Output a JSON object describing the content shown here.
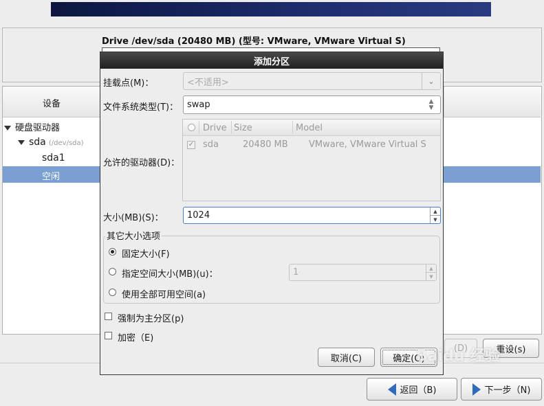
{
  "drive": {
    "title": "Drive /dev/sda (20480 MB) (型号: VMware, VMware Virtual S)"
  },
  "tree": {
    "column_device": "设备",
    "items": [
      {
        "label": "硬盘驱动器"
      },
      {
        "label": "sda",
        "sub": "(/dev/sda)"
      },
      {
        "label": "sda1"
      },
      {
        "label": "空闲"
      }
    ]
  },
  "dialog": {
    "title": "添加分区",
    "mount_point_label": "挂载点(M)：",
    "mount_point_value": "<不适用>",
    "fstype_label": "文件系统类型(T)：",
    "fstype_value": "swap",
    "allowed_drives_label": "允许的驱动器(D)：",
    "drives_table": {
      "headers": [
        "Drive",
        "Size",
        "Model"
      ],
      "rows": [
        {
          "drive": "sda",
          "size": "20480 MB",
          "model": "VMware, VMware Virtual S",
          "checked": true
        }
      ]
    },
    "size_label": "大小(MB)(S)：",
    "size_value": "1024",
    "other_size_legend": "其它大小选项",
    "opt_fixed": "固定大小(F)",
    "opt_max": "指定空间大小(MB)(u)：",
    "opt_max_value": "1",
    "opt_fill": "使用全部可用空间(a)",
    "selected_option": "fixed",
    "force_primary": "强制为主分区(p)",
    "encrypt": "加密（E)",
    "cancel": "取消(C)",
    "ok": "确定(O)"
  },
  "buttons": {
    "d": "(D)",
    "reset": "重设(s)",
    "back": "返回（B)",
    "next": "下一步（N)"
  },
  "watermark": "Baidu 经验"
}
